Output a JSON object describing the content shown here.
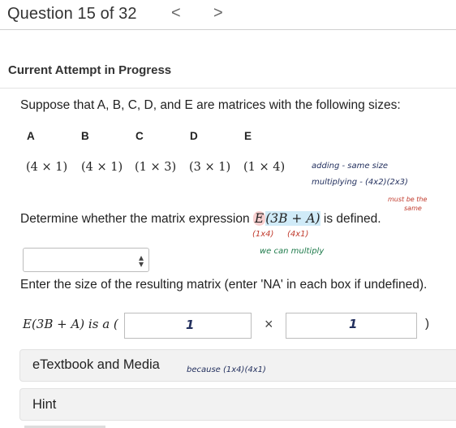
{
  "header": {
    "question_label": "Question 15 of 32",
    "prev_icon": "<",
    "next_icon": ">"
  },
  "status": {
    "attempt_label": "Current Attempt in Progress"
  },
  "question": {
    "prompt": "Suppose that A, B, C, D, and E are matrices with the following sizes:",
    "matrices": [
      {
        "name": "A",
        "size": "(4 × 1)"
      },
      {
        "name": "B",
        "size": "(4 × 1)"
      },
      {
        "name": "C",
        "size": "(1 × 3)"
      },
      {
        "name": "D",
        "size": "(3 × 1)"
      },
      {
        "name": "E",
        "size": "(1 × 4)"
      }
    ],
    "determine_prefix": "Determine whether the matrix expression ",
    "determine_E": "E",
    "determine_paren": "(3B + A)",
    "determine_suffix": " is defined.",
    "defined_select_value": "",
    "instruction": "Enter the size of the resulting matrix (enter 'NA' in each box if undefined).",
    "result_label": "E(3B + A) is a (",
    "rows_value": "",
    "cols_value": "",
    "times_symbol": "×",
    "close_paren": ")"
  },
  "resources": {
    "etextbook_label": "eTextbook and Media",
    "hint_label": "Hint"
  },
  "annotations": {
    "adding": "adding - same size",
    "multiplying": "multiplying - (4x2)(2x3)",
    "must_be": "must be the",
    "same": "same",
    "dims_E": "(1x4)",
    "dims_B": "(4x1)",
    "we_can": "we can multiply",
    "box1_mark": "1",
    "box2_mark": "1",
    "because": "because (1x4)(4x1)"
  },
  "colors": {
    "annotation_green": "#1d7a4a",
    "annotation_navy": "#23305e",
    "annotation_red": "#c0392b",
    "highlight_pink": "#f09696",
    "highlight_blue": "#96d2f0"
  }
}
